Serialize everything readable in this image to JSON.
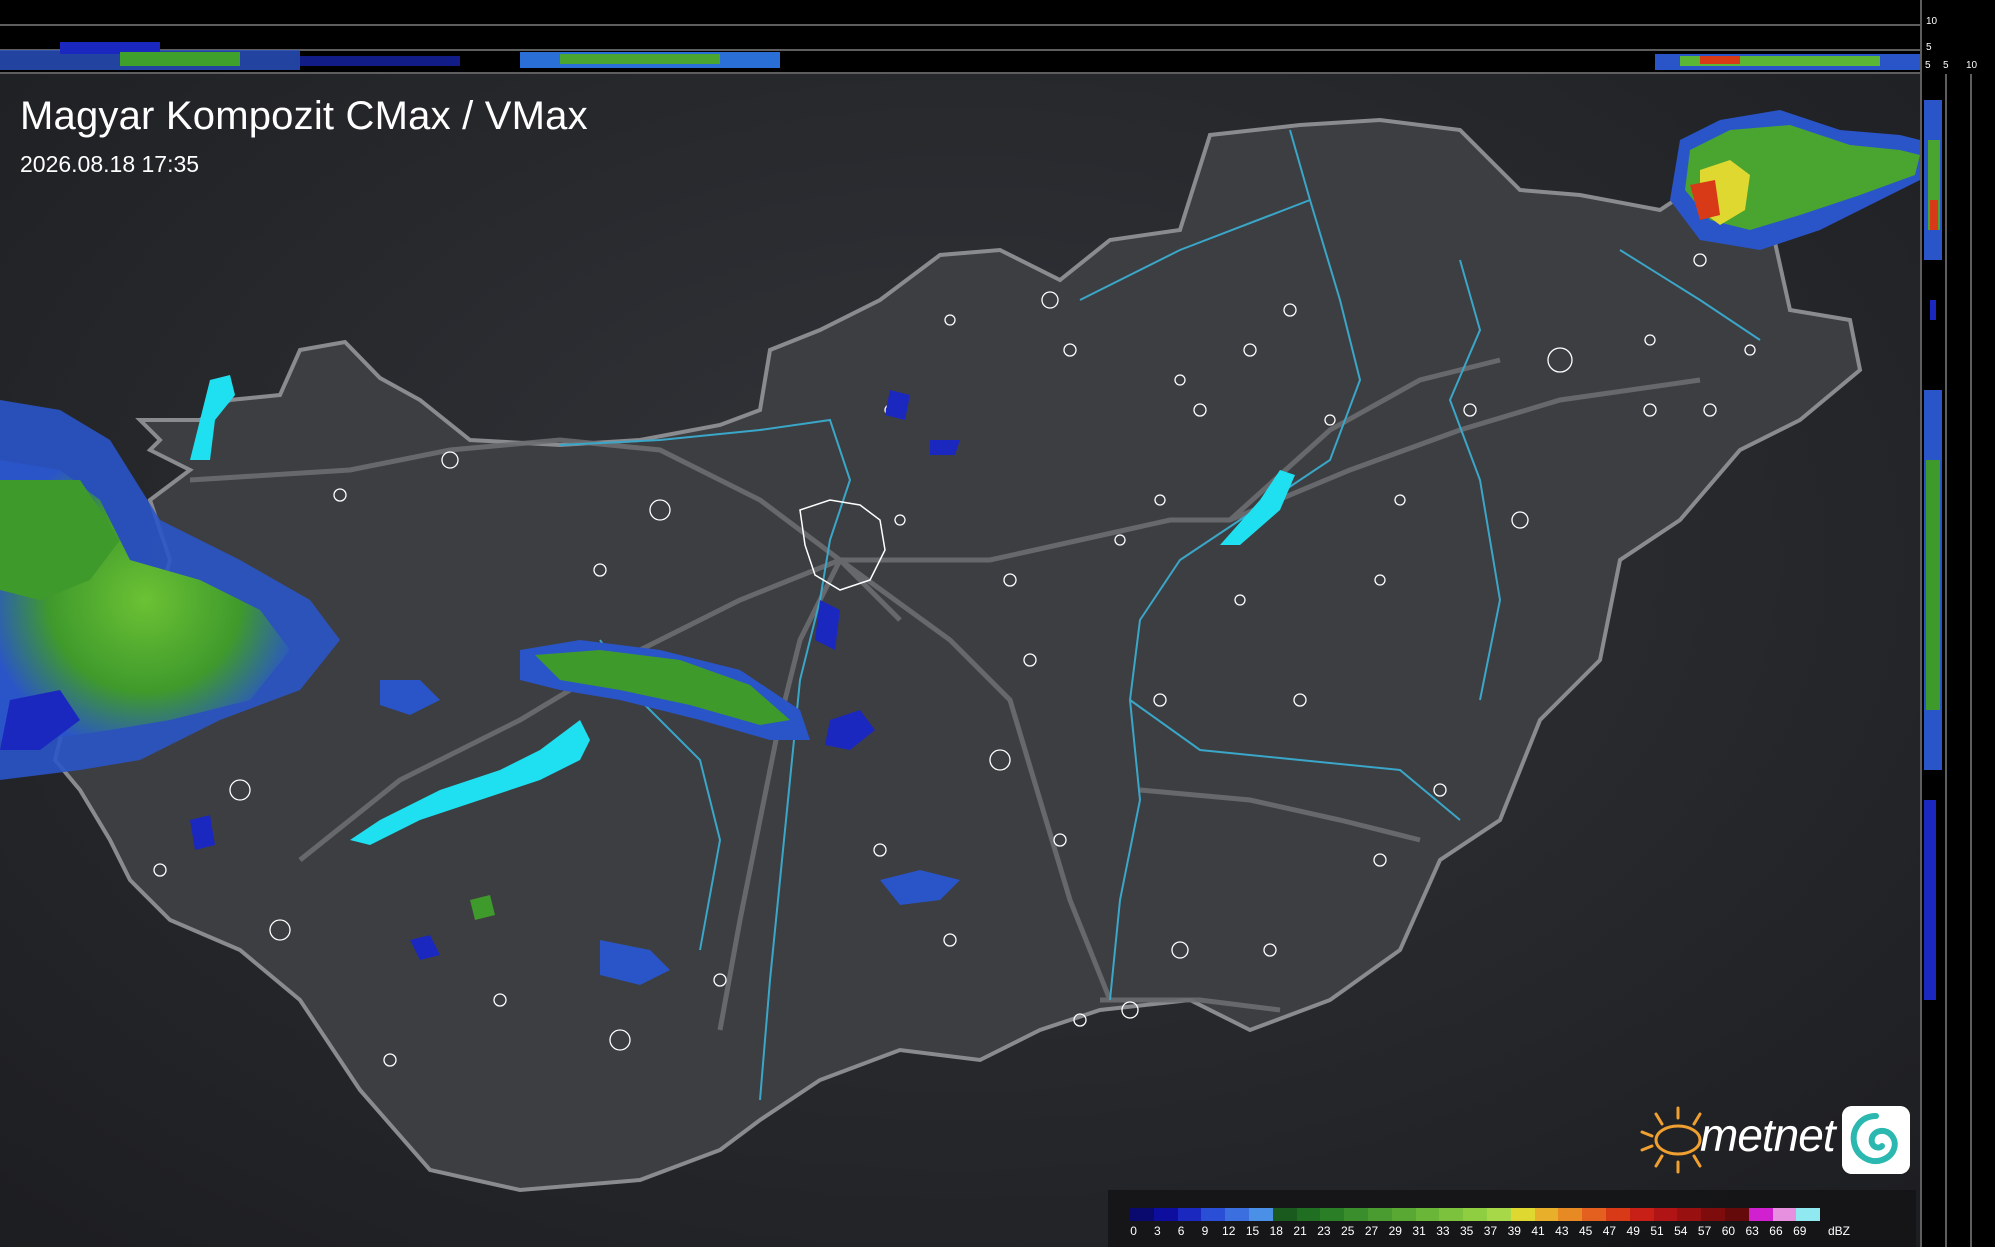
{
  "title": "Magyar Kompozit CMax / VMax",
  "timestamp": "2026.08.18 17:35",
  "brand": {
    "name": "metnet",
    "sun_icon": "sun-icon",
    "logo_icon": "swirl-logo-icon"
  },
  "side_profile_axis": {
    "top_labels": [
      "10",
      "5"
    ],
    "right_labels": [
      "5",
      "10"
    ],
    "top_corner_label": "5"
  },
  "legend": {
    "unit": "dBZ",
    "labels": [
      "0",
      "3",
      "6",
      "9",
      "12",
      "15",
      "18",
      "21",
      "23",
      "25",
      "27",
      "29",
      "31",
      "33",
      "35",
      "37",
      "39",
      "41",
      "43",
      "45",
      "47",
      "49",
      "51",
      "54",
      "57",
      "60",
      "63",
      "66",
      "69"
    ],
    "colors": [
      "#0a0a6e",
      "#0d0d9e",
      "#1a28c0",
      "#2a4fd6",
      "#3b6fe0",
      "#4a90e6",
      "#1a5a1e",
      "#1f6e22",
      "#2a7e26",
      "#3a8e2c",
      "#4a9c30",
      "#5aa834",
      "#6ab638",
      "#7cc23c",
      "#8ece40",
      "#a6d848",
      "#dfd830",
      "#e8b02a",
      "#e88a24",
      "#e4601e",
      "#d83a18",
      "#c82016",
      "#b01414",
      "#981010",
      "#7e0c0c",
      "#640a0a",
      "#d020d0",
      "#e890e0",
      "#90e8f0"
    ]
  },
  "map_colors": {
    "background": "#2b2d31",
    "country": "#3d3e42",
    "border": "#8a8b8e",
    "roads": "#6c6d70",
    "rivers": "#3aa6c8",
    "lakes": "#1fe0f0",
    "towns": "#ffffff"
  }
}
